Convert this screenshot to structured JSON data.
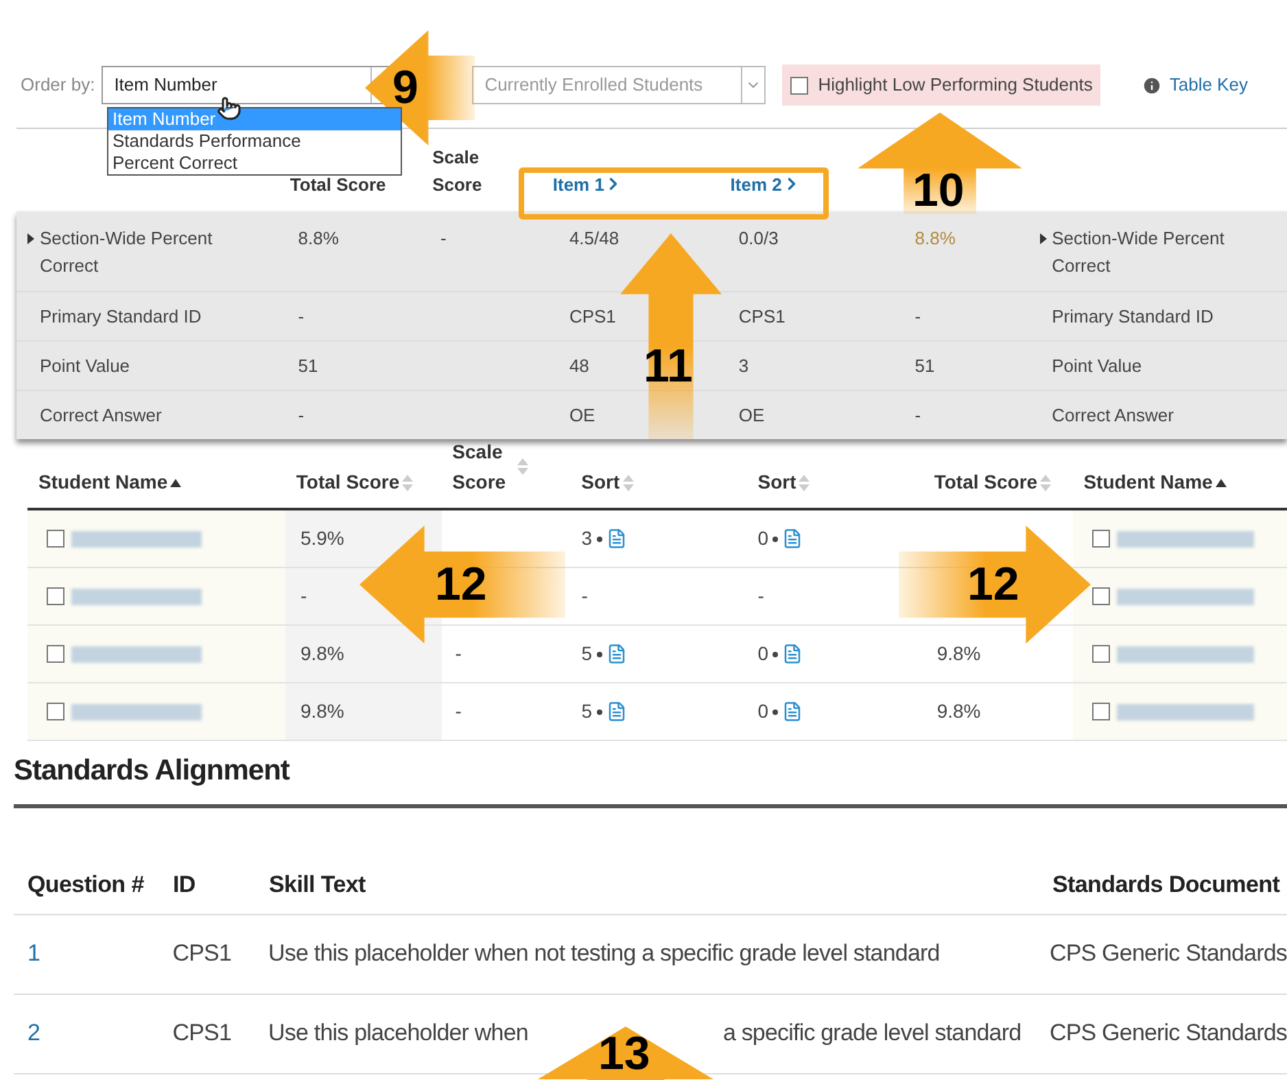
{
  "toolbar": {
    "order_label": "Order by:",
    "order_value": "Item Number",
    "order_options": [
      {
        "label": "Item Number",
        "selected": true
      },
      {
        "label": "Standards Performance",
        "selected": false
      },
      {
        "label": "Percent Correct",
        "selected": false
      }
    ],
    "roster_value": "Currently Enrolled Students",
    "highlight": {
      "label": "Highlight Low Performing Students",
      "checked": false
    },
    "table_key": "Table Key"
  },
  "summary": {
    "columns": [
      null,
      "Total Score",
      "Scale Score",
      {
        "kind": "link",
        "label": "Item 1"
      },
      {
        "kind": "link",
        "label": "Item 2"
      },
      null,
      null
    ],
    "rows": [
      {
        "expandable": true,
        "cells": [
          "Section-Wide Percent Correct",
          "8.8%",
          "-",
          "4.5/48",
          "0.0/3",
          "8.8%",
          "Section-Wide Percent Correct"
        ]
      },
      {
        "expandable": false,
        "cells": [
          "Primary Standard ID",
          "-",
          null,
          "CPS1",
          "CPS1",
          "-",
          "Primary Standard ID"
        ]
      },
      {
        "expandable": false,
        "cells": [
          "Point Value",
          "51",
          null,
          "48",
          "3",
          "51",
          "Point Value"
        ]
      },
      {
        "expandable": false,
        "cells": [
          "Correct Answer",
          "-",
          null,
          "OE",
          "OE",
          "-",
          "Correct Answer"
        ]
      }
    ]
  },
  "students": {
    "columns": [
      {
        "label": "Student Name",
        "sorted": true
      },
      {
        "label": "Total Score",
        "sorted": false
      },
      {
        "label": "Scale Score",
        "sorted": false
      },
      {
        "label": "Sort",
        "sorted": false
      },
      {
        "label": "Sort",
        "sorted": false
      },
      {
        "label": "Total Score",
        "sorted": false
      },
      {
        "label": "Student Name",
        "sorted": true
      }
    ],
    "rows": [
      {
        "checked": false,
        "total": "5.9%",
        "scale": null,
        "items": [
          {
            "value": "3",
            "report": true
          },
          {
            "value": "0",
            "report": true
          }
        ],
        "right_total": null,
        "right_checked": false
      },
      {
        "checked": false,
        "total": "-",
        "scale": null,
        "items": [
          {
            "value": "-",
            "report": false
          },
          {
            "value": "-",
            "report": false
          }
        ],
        "right_total": null,
        "right_checked": false
      },
      {
        "checked": false,
        "total": "9.8%",
        "scale": "-",
        "items": [
          {
            "value": "5",
            "report": true
          },
          {
            "value": "0",
            "report": true
          }
        ],
        "right_total": "9.8%",
        "right_checked": false
      },
      {
        "checked": false,
        "total": "9.8%",
        "scale": "-",
        "items": [
          {
            "value": "5",
            "report": true
          },
          {
            "value": "0",
            "report": true
          }
        ],
        "right_total": "9.8%",
        "right_checked": false
      }
    ]
  },
  "standards": {
    "title": "Standards Alignment",
    "columns": [
      "Question #",
      "ID",
      "Skill Text",
      "Standards Document"
    ],
    "rows": [
      {
        "question": "1",
        "id": "CPS1",
        "skill_text": [
          "Use this placeholder when not testing a specific grade level standard"
        ],
        "document": "CPS Generic Standards"
      },
      {
        "question": "2",
        "id": "CPS1",
        "skill_text": [
          "Use this placeholder when",
          "a specific grade level standard"
        ],
        "document": "CPS Generic Standards"
      }
    ]
  },
  "callouts": [
    {
      "number": "9",
      "kind": "left"
    },
    {
      "number": "10",
      "kind": "up"
    },
    {
      "number": "11",
      "kind": "up"
    },
    {
      "number": "12",
      "kind": "left"
    },
    {
      "number": "12",
      "kind": "right"
    },
    {
      "number": "13",
      "kind": "up"
    }
  ]
}
